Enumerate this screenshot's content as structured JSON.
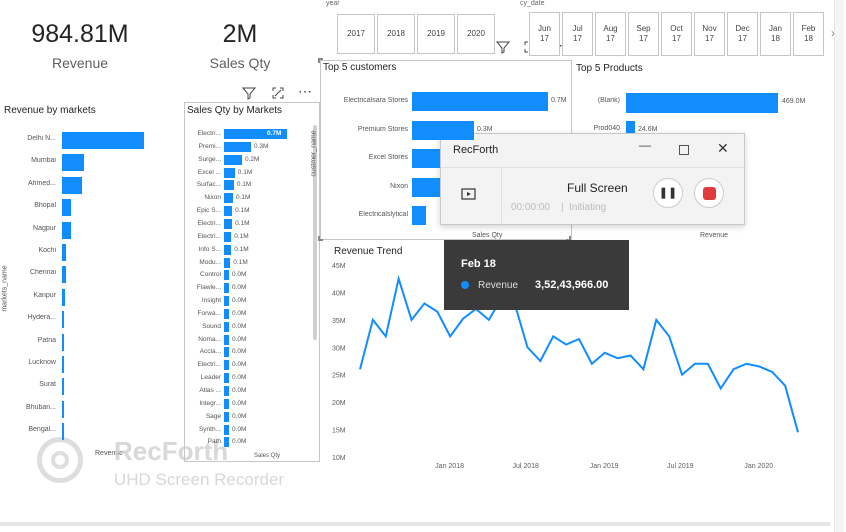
{
  "kpis": [
    {
      "value": "984.81M",
      "label": "Revenue"
    },
    {
      "value": "2M",
      "label": "Sales Qty"
    }
  ],
  "slicers": {
    "year": {
      "title": "year",
      "items": [
        "2017",
        "2018",
        "2019",
        "2020"
      ]
    },
    "cy_date": {
      "title": "cy_date",
      "items": [
        "Jun\n17",
        "Jul\n17",
        "Aug\n17",
        "Sep\n17",
        "Oct\n17",
        "Nov\n17",
        "Dec\n17",
        "Jan\n18",
        "Feb\n18"
      ],
      "next_icon": "chevron-right-icon"
    }
  },
  "revenue_by_markets": {
    "title": "Revenue by markets",
    "axis_label": "markets_name",
    "x_axis_label": "Revenue",
    "categories": [
      "Delhi N...",
      "Mumbai",
      "Ahmed...",
      "Bhopal",
      "Nagpur",
      "Kochi",
      "Chennai",
      "Kanpur",
      "Hydera...",
      "Patna",
      "Lucknow",
      "Surat",
      "Bhuban...",
      "Bengal..."
    ]
  },
  "sales_qty_by_markets": {
    "title": "Sales Qty by Markets",
    "x_axis_label": "Sales Qty",
    "rows": [
      {
        "name": "Electri...",
        "value": "0.7M",
        "v": 0.7
      },
      {
        "name": "Premi...",
        "value": "0.3M",
        "v": 0.3
      },
      {
        "name": "Surge...",
        "value": "0.2M",
        "v": 0.2
      },
      {
        "name": "Excel ...",
        "value": "0.1M",
        "v": 0.12
      },
      {
        "name": "Surfac...",
        "value": "0.1M",
        "v": 0.11
      },
      {
        "name": "Nixon",
        "value": "0.1M",
        "v": 0.1
      },
      {
        "name": "Epic S...",
        "value": "0.1M",
        "v": 0.09
      },
      {
        "name": "Electri...",
        "value": "0.1M",
        "v": 0.09
      },
      {
        "name": "Electri...",
        "value": "0.1M",
        "v": 0.08
      },
      {
        "name": "Info S...",
        "value": "0.1M",
        "v": 0.08
      },
      {
        "name": "Modu...",
        "value": "0.1M",
        "v": 0.07
      },
      {
        "name": "Control",
        "value": "0.0M",
        "v": 0.05
      },
      {
        "name": "Flawle...",
        "value": "0.0M",
        "v": 0.05
      },
      {
        "name": "Insight",
        "value": "0.0M",
        "v": 0.04
      },
      {
        "name": "Forwa...",
        "value": "0.0M",
        "v": 0.04
      },
      {
        "name": "Sound",
        "value": "0.0M",
        "v": 0.04
      },
      {
        "name": "Noma...",
        "value": "0.0M",
        "v": 0.04
      },
      {
        "name": "Accla...",
        "value": "0.0M",
        "v": 0.04
      },
      {
        "name": "Electri...",
        "value": "0.0M",
        "v": 0.04
      },
      {
        "name": "Leader",
        "value": "0.0M",
        "v": 0.03
      },
      {
        "name": "Atlas ...",
        "value": "0.0M",
        "v": 0.03
      },
      {
        "name": "Integr...",
        "value": "0.0M",
        "v": 0.03
      },
      {
        "name": "Sage",
        "value": "0.0M",
        "v": 0.03
      },
      {
        "name": "Synth...",
        "value": "0.0M",
        "v": 0.03
      },
      {
        "name": "Path",
        "value": "0.0M",
        "v": 0.03
      }
    ]
  },
  "top5_customers": {
    "title": "Top 5 customers",
    "axis_label": "custmer_name",
    "x_axis_label": "Sales Qty",
    "rows": [
      {
        "name": "Electricalsara Stores",
        "value": "0.7M"
      },
      {
        "name": "Premium Stores",
        "value": "0.3M"
      },
      {
        "name": "Excel Stores",
        "value": ""
      },
      {
        "name": "Nixon",
        "value": ""
      },
      {
        "name": "Electricalslytical",
        "value": ""
      }
    ]
  },
  "top5_products": {
    "title": "Top 5 Products",
    "x_axis_label": "Revenue",
    "rows": [
      {
        "name": "(Blank)",
        "value": "469.0M"
      },
      {
        "name": "Prod040",
        "value": "24.6M"
      }
    ]
  },
  "revenue_trend": {
    "title": "Revenue Trend",
    "y_ticks": [
      "45M",
      "40M",
      "35M",
      "30M",
      "25M",
      "20M",
      "15M",
      "10M"
    ],
    "x_ticks": [
      "Jan 2018",
      "Jul 2018",
      "Jan 2019",
      "Jul 2019",
      "Jan 2020"
    ]
  },
  "chart_data": {
    "type": "line",
    "title": "Revenue Trend",
    "ylim": [
      10,
      45
    ],
    "y_unit": "M",
    "x": [
      "Jun 17",
      "Jul 17",
      "Aug 17",
      "Sep 17",
      "Oct 17",
      "Nov 17",
      "Dec 17",
      "Jan 18",
      "Feb 18",
      "Mar 18",
      "Apr 18",
      "May 18",
      "Jun 18",
      "Jul 18",
      "Aug 18",
      "Sep 18",
      "Oct 18",
      "Nov 18",
      "Dec 18",
      "Jan 19",
      "Feb 19",
      "Mar 19",
      "Apr 19",
      "May 19",
      "Jun 19",
      "Jul 19",
      "Aug 19",
      "Sep 19",
      "Oct 19",
      "Nov 19",
      "Dec 19",
      "Jan 20",
      "Feb 20",
      "Mar 20",
      "Apr 20",
      "May 20",
      "Jun 20"
    ],
    "values": [
      26,
      35,
      32,
      42.5,
      35,
      38,
      36.5,
      32,
      35.2,
      37,
      35,
      39,
      38,
      30,
      27.5,
      32,
      30.5,
      31.5,
      27,
      29,
      28,
      28.5,
      26,
      35,
      32,
      25,
      27,
      27,
      22.5,
      26,
      27,
      26.5,
      25.5,
      23,
      14.5
    ]
  },
  "tooltip": {
    "title": "Feb 18",
    "series": "Revenue",
    "value": "3,52,43,966.00"
  },
  "recorder": {
    "title": "RecForth",
    "mode": "Full Screen",
    "time": "00:00:00",
    "status": "Initiating",
    "watermark_name": "RecForth",
    "watermark_sub": "UHD Screen Recorder"
  }
}
